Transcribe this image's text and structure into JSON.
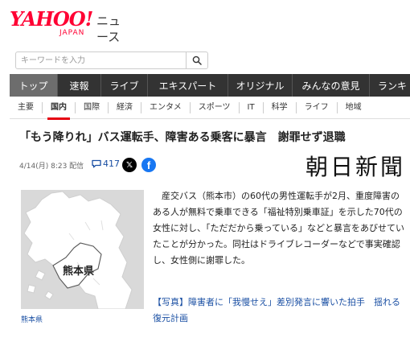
{
  "header": {
    "logo_main": "YAHOO!",
    "logo_sub": "JAPAN",
    "logo_news": "ニュース"
  },
  "search": {
    "placeholder": "キーワードを入力"
  },
  "main_nav": {
    "tabs": [
      {
        "label": "トップ",
        "active": true
      },
      {
        "label": "速報"
      },
      {
        "label": "ライブ"
      },
      {
        "label": "エキスパート"
      },
      {
        "label": "オリジナル"
      },
      {
        "label": "みんなの意見"
      },
      {
        "label": "ランキ"
      }
    ]
  },
  "sub_nav": {
    "items": [
      {
        "label": "主要"
      },
      {
        "label": "国内",
        "active": true
      },
      {
        "label": "国際"
      },
      {
        "label": "経済"
      },
      {
        "label": "エンタメ"
      },
      {
        "label": "スポーツ"
      },
      {
        "label": "IT"
      },
      {
        "label": "科学"
      },
      {
        "label": "ライフ"
      },
      {
        "label": "地域"
      }
    ]
  },
  "article": {
    "title": "「もう降りれ」バス運転手、障害ある乗客に暴言　謝罪せず退職",
    "meta": "4/14(月) 8:23 配信",
    "comment_count": "417",
    "publisher": "朝日新聞",
    "map_label": "熊本県",
    "map_caption": "熊本県",
    "body": "産交バス（熊本市）の60代の男性運転手が2月、重度障害のある人が無料で乗車できる「福祉特別乗車証」を示した70代の女性に対し、「ただだから乗っている」などと暴言をあびせていたことが分かった。同社はドライブレコーダーなどで事実確認し、女性側に謝罪した。",
    "related_tag": "【写真】",
    "related_text": "障害者に「我慢せえ」差別発言に響いた拍手　揺れる復元計画"
  },
  "colors": {
    "brand_red": "#ff0033",
    "nav_bg": "#333333",
    "nav_active": "#6d6d6d",
    "link_blue": "#1a4fa3",
    "facebook_blue": "#1877f2"
  },
  "icons": [
    "search-icon",
    "comment-icon",
    "x-icon",
    "facebook-icon"
  ]
}
